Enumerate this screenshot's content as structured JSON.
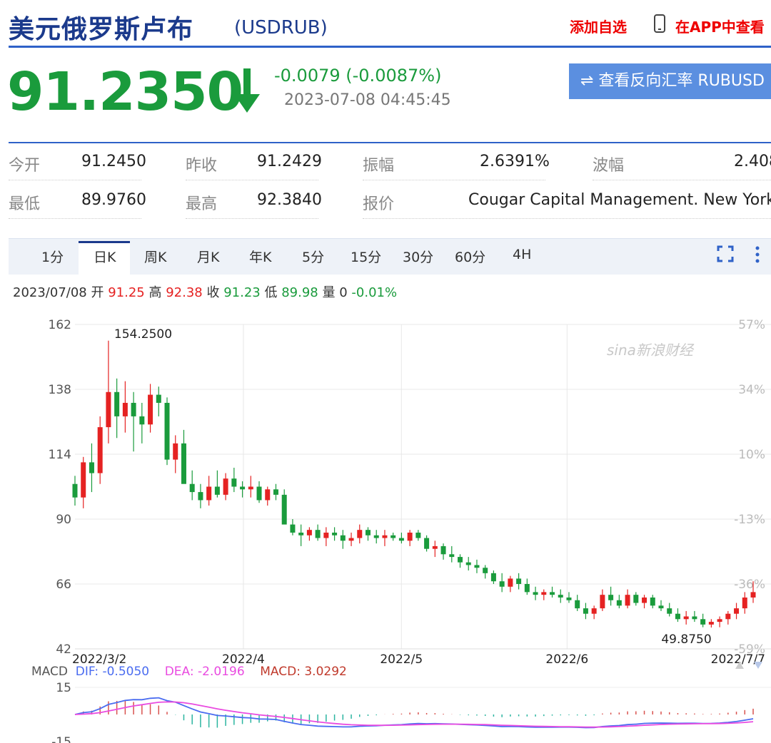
{
  "header": {
    "title": "美元俄罗斯卢布",
    "code": "(USDRUB)",
    "add_favorite": "添加自选",
    "app_link": "在APP中查看"
  },
  "quote": {
    "price": "91.2350",
    "change": "-0.0079 (-0.0087%)",
    "datetime": "2023-07-08 04:45:45",
    "reverse_button": "⇌ 查看反向汇率 RUBUSD",
    "direction": "down",
    "down_color": "#1a9b3c",
    "up_color": "#e52222"
  },
  "stats": {
    "open_label": "今开",
    "open": "91.2450",
    "prev_close_label": "昨收",
    "prev_close": "91.2429",
    "amplitude_label": "振幅",
    "amplitude": "2.6391%",
    "range_label": "波幅",
    "range": "2.408",
    "low_label": "最低",
    "low": "89.9760",
    "high_label": "最高",
    "high": "92.3840",
    "quote_label": "报价",
    "quote_source": "Cougar Capital Management. New York"
  },
  "tabs": [
    {
      "label": "1分"
    },
    {
      "label": "日K",
      "active": true
    },
    {
      "label": "周K"
    },
    {
      "label": "月K"
    },
    {
      "label": "年K"
    },
    {
      "label": "5分"
    },
    {
      "label": "15分"
    },
    {
      "label": "30分"
    },
    {
      "label": "60分"
    },
    {
      "label": "4H"
    }
  ],
  "ohlc": {
    "date": "2023/07/08",
    "open_label": "开",
    "open": "91.25",
    "high_label": "高",
    "high": "92.38",
    "close_label": "收",
    "close": "91.23",
    "low_label": "低",
    "low": "89.98",
    "volume_label": "量",
    "volume": "0",
    "pct": "-0.01%"
  },
  "macd_legend": {
    "label": "MACD",
    "dif": "DIF: -0.5050",
    "dea": "DEA: -2.0196",
    "macd": "MACD: 3.0292"
  },
  "watermark": "sina新浪财经",
  "chart_data": {
    "type": "candlestick",
    "y_ticks": [
      "162",
      "138",
      "114",
      "90",
      "66",
      "42"
    ],
    "y_pct_ticks": [
      "57%",
      "34%",
      "10%",
      "-13%",
      "-36%",
      "-59%"
    ],
    "ylim": [
      42,
      162
    ],
    "x_labels": [
      "2022/3/2",
      "2022/4",
      "2022/5",
      "2022/6",
      "2022/7/7"
    ],
    "max_label": "154.2500",
    "min_label": "49.8750",
    "up_color": "#e52222",
    "down_color": "#1a9b3c",
    "candles_ohlc": [
      [
        103,
        106,
        95,
        98
      ],
      [
        98,
        113,
        94,
        111
      ],
      [
        111,
        118,
        100,
        107
      ],
      [
        107,
        128,
        103,
        124
      ],
      [
        124,
        156,
        118,
        137
      ],
      [
        137,
        142,
        120,
        128
      ],
      [
        128,
        141,
        122,
        133
      ],
      [
        133,
        137,
        115,
        128
      ],
      [
        128,
        133,
        118,
        125
      ],
      [
        125,
        140,
        122,
        136
      ],
      [
        136,
        139,
        128,
        133
      ],
      [
        133,
        135,
        110,
        112
      ],
      [
        112,
        121,
        107,
        118
      ],
      [
        118,
        123,
        112,
        103
      ],
      [
        103,
        108,
        97,
        100
      ],
      [
        100,
        103,
        94,
        97
      ],
      [
        97,
        106,
        95,
        102
      ],
      [
        102,
        108,
        98,
        99
      ],
      [
        99,
        107,
        97,
        105
      ],
      [
        105,
        109,
        100,
        102
      ],
      [
        102,
        104,
        98,
        101
      ],
      [
        101,
        106,
        98,
        102
      ],
      [
        102,
        104,
        96,
        97
      ],
      [
        97,
        102,
        95,
        101
      ],
      [
        101,
        103,
        97,
        99
      ],
      [
        99,
        101,
        92,
        88
      ],
      [
        88,
        90,
        84,
        85
      ],
      [
        85,
        88,
        80,
        84
      ],
      [
        84,
        87,
        82,
        86
      ],
      [
        86,
        88,
        82,
        83
      ],
      [
        83,
        87,
        80,
        85
      ],
      [
        85,
        87,
        82,
        84
      ],
      [
        84,
        86,
        79,
        82
      ],
      [
        82,
        85,
        80,
        83
      ],
      [
        83,
        88,
        81,
        86
      ],
      [
        86,
        87,
        82,
        84
      ],
      [
        84,
        86,
        81,
        83
      ],
      [
        83,
        86,
        80,
        84
      ],
      [
        84,
        85,
        82,
        83
      ],
      [
        83,
        85,
        81,
        82
      ],
      [
        82,
        86,
        80,
        85
      ],
      [
        85,
        86,
        82,
        83
      ],
      [
        83,
        84,
        78,
        79
      ],
      [
        79,
        82,
        76,
        80
      ],
      [
        80,
        81,
        75,
        77
      ],
      [
        77,
        80,
        74,
        76
      ],
      [
        76,
        77,
        72,
        74
      ],
      [
        74,
        76,
        71,
        73
      ],
      [
        73,
        75,
        70,
        72
      ],
      [
        72,
        73,
        68,
        70
      ],
      [
        70,
        71,
        66,
        67
      ],
      [
        67,
        70,
        63,
        65
      ],
      [
        65,
        69,
        63,
        68
      ],
      [
        68,
        70,
        64,
        66
      ],
      [
        66,
        68,
        62,
        63
      ],
      [
        63,
        65,
        60,
        62
      ],
      [
        62,
        64,
        60,
        63
      ],
      [
        63,
        65,
        61,
        62
      ],
      [
        62,
        64,
        59,
        61
      ],
      [
        61,
        63,
        59,
        60
      ],
      [
        60,
        62,
        56,
        57
      ],
      [
        57,
        59,
        53,
        55
      ],
      [
        55,
        58,
        53,
        57
      ],
      [
        57,
        64,
        56,
        62
      ],
      [
        62,
        65,
        58,
        60
      ],
      [
        60,
        62,
        57,
        58
      ],
      [
        58,
        64,
        57,
        62
      ],
      [
        62,
        63,
        58,
        59
      ],
      [
        59,
        62,
        57,
        61
      ],
      [
        61,
        62,
        57,
        58
      ],
      [
        58,
        60,
        56,
        57
      ],
      [
        57,
        59,
        54,
        55
      ],
      [
        55,
        57,
        52,
        53
      ],
      [
        53,
        56,
        51,
        54
      ],
      [
        54,
        56,
        52,
        53
      ],
      [
        53,
        55,
        50,
        51
      ],
      [
        51,
        53,
        49.9,
        52
      ],
      [
        52,
        54,
        50,
        53
      ],
      [
        53,
        56,
        51,
        55
      ],
      [
        55,
        59,
        53,
        57
      ],
      [
        57,
        63,
        55,
        61
      ],
      [
        61,
        67,
        59,
        63
      ]
    ],
    "macd_ylim": [
      -15,
      15
    ],
    "macd_ticks": [
      "15",
      "-15"
    ]
  }
}
